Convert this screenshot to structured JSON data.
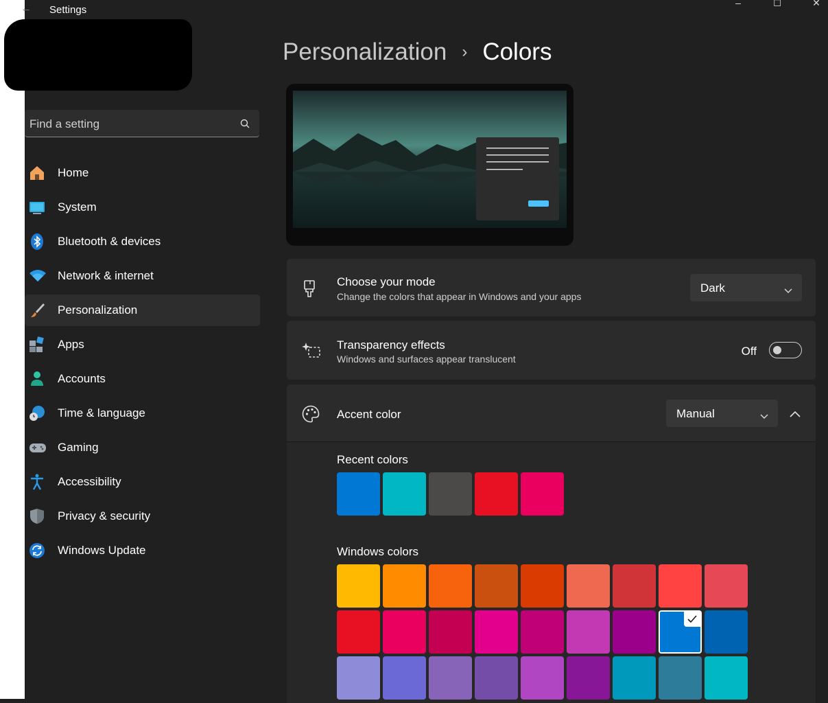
{
  "window": {
    "title": "Settings",
    "back_icon": "arrow-left-icon",
    "minimize": "–",
    "maximize": "☐",
    "close": "✕"
  },
  "search": {
    "placeholder": "Find a setting"
  },
  "nav": {
    "items": [
      {
        "label": "Home",
        "icon": "home-icon"
      },
      {
        "label": "System",
        "icon": "system-icon"
      },
      {
        "label": "Bluetooth & devices",
        "icon": "bluetooth-icon"
      },
      {
        "label": "Network & internet",
        "icon": "wifi-icon"
      },
      {
        "label": "Personalization",
        "icon": "paintbrush-icon",
        "selected": true
      },
      {
        "label": "Apps",
        "icon": "apps-icon"
      },
      {
        "label": "Accounts",
        "icon": "account-icon"
      },
      {
        "label": "Time & language",
        "icon": "globe-clock-icon"
      },
      {
        "label": "Gaming",
        "icon": "gamepad-icon"
      },
      {
        "label": "Accessibility",
        "icon": "accessibility-icon"
      },
      {
        "label": "Privacy & security",
        "icon": "shield-icon"
      },
      {
        "label": "Windows Update",
        "icon": "update-icon"
      }
    ]
  },
  "breadcrumb": {
    "parent": "Personalization",
    "separator": "›",
    "current": "Colors"
  },
  "mode": {
    "title": "Choose your mode",
    "subtitle": "Change the colors that appear in Windows and your apps",
    "value": "Dark"
  },
  "transparency": {
    "title": "Transparency effects",
    "subtitle": "Windows and surfaces appear translucent",
    "state": "Off"
  },
  "accent": {
    "title": "Accent color",
    "value": "Manual"
  },
  "recent_colors": {
    "label": "Recent colors",
    "colors": [
      "#0078d4",
      "#00b7c3",
      "#4c4a48",
      "#e81123",
      "#ea005e"
    ]
  },
  "windows_colors": {
    "label": "Windows colors",
    "selected_index": 16,
    "colors": [
      "#ffb900",
      "#ff8c00",
      "#f7630c",
      "#ca5010",
      "#da3b01",
      "#ef6950",
      "#d13438",
      "#ff4343",
      "#e74856",
      "#e81123",
      "#ea005e",
      "#c30052",
      "#e3008c",
      "#bf0077",
      "#c239b3",
      "#9a0089",
      "#0078d4",
      "#0063b1",
      "#8e8cd8",
      "#6b69d6",
      "#8764b8",
      "#744da9",
      "#b146c2",
      "#881798",
      "#0099bc",
      "#2d7d9a",
      "#00b7c3"
    ]
  }
}
